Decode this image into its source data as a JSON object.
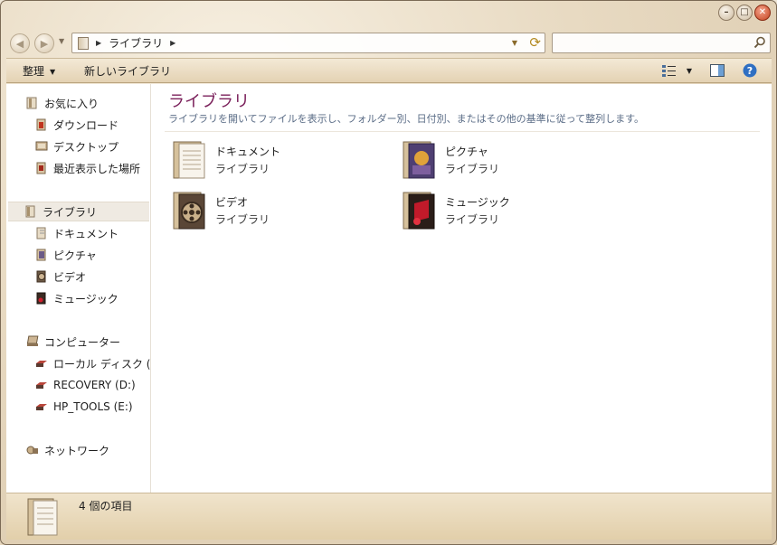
{
  "window": {
    "caption": {
      "minimize": "–",
      "maximize": "□",
      "close": "✕"
    }
  },
  "address_bar": {
    "back_icon": "back-arrow-icon",
    "forward_icon": "forward-arrow-icon",
    "separator": "▶",
    "crumbs": [
      "ライブラリ"
    ],
    "refresh_icon": "refresh-icon"
  },
  "search": {
    "placeholder": "",
    "value": ""
  },
  "commands": {
    "organize": "整理",
    "new_library": "新しいライブラリ",
    "caret": "▼"
  },
  "nav_pane": {
    "favorites": {
      "label": "お気に入り",
      "items": [
        "ダウンロード",
        "デスクトップ",
        "最近表示した場所"
      ]
    },
    "libraries": {
      "label": "ライブラリ",
      "items": [
        "ドキュメント",
        "ピクチャ",
        "ビデオ",
        "ミュージック"
      ]
    },
    "computer": {
      "label": "コンピューター",
      "items": [
        "ローカル ディスク (",
        "RECOVERY (D:)",
        "HP_TOOLS (E:)"
      ]
    },
    "network": {
      "label": "ネットワーク"
    }
  },
  "main": {
    "title": "ライブラリ",
    "subtitle": "ライブラリを開いてファイルを表示し、フォルダー別、日付別、またはその他の基準に従って整列します。",
    "tiles": [
      {
        "name": "ドキュメント",
        "type": "ライブラリ",
        "icon": "documents-library-icon"
      },
      {
        "name": "ピクチャ",
        "type": "ライブラリ",
        "icon": "pictures-library-icon"
      },
      {
        "name": "ビデオ",
        "type": "ライブラリ",
        "icon": "videos-library-icon"
      },
      {
        "name": "ミュージック",
        "type": "ライブラリ",
        "icon": "music-library-icon"
      }
    ]
  },
  "status": {
    "count": "4 個の項目"
  },
  "colors": {
    "title": "#7a1f5a",
    "subtitle": "#5a6c86",
    "chrome": "#e6d6bc",
    "selection": "#efeae2"
  }
}
